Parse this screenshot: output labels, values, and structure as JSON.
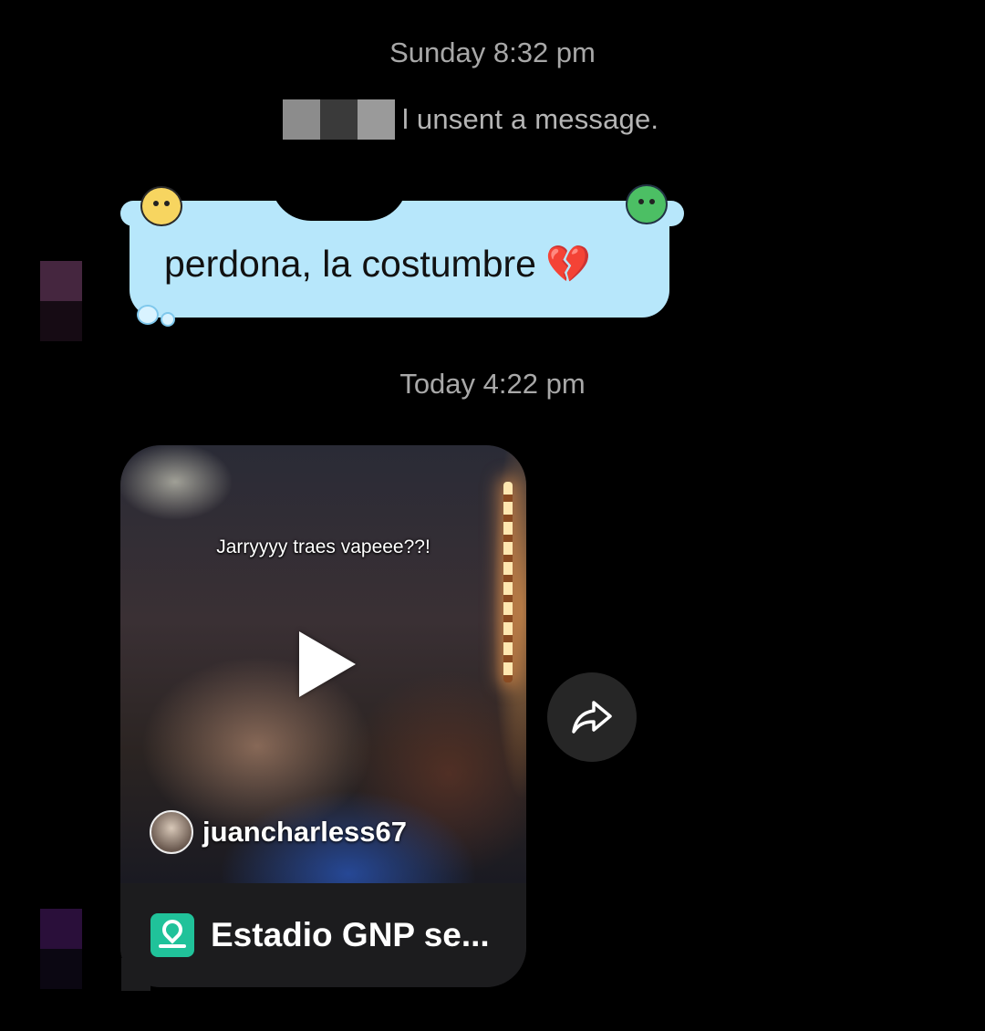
{
  "thread": {
    "timestamp_1": "Sunday 8:32 pm",
    "unsent_notice": "l unsent a message.",
    "message_text": "perdona, la costumbre",
    "message_emoji": "💔",
    "timestamp_2": "Today 4:22 pm"
  },
  "shared_post": {
    "caption": "Jarryyyy traes vapeee??!",
    "author": "juancharless67",
    "location": "Estadio GNP se...",
    "location_icon": "map-pin-icon",
    "play_icon": "play-icon"
  },
  "actions": {
    "share_icon": "share-arrow-icon"
  },
  "colors": {
    "background": "#000000",
    "bubble": "#b7e7fb",
    "location_icon": "#20c29a",
    "card": "#1c1c1e"
  }
}
